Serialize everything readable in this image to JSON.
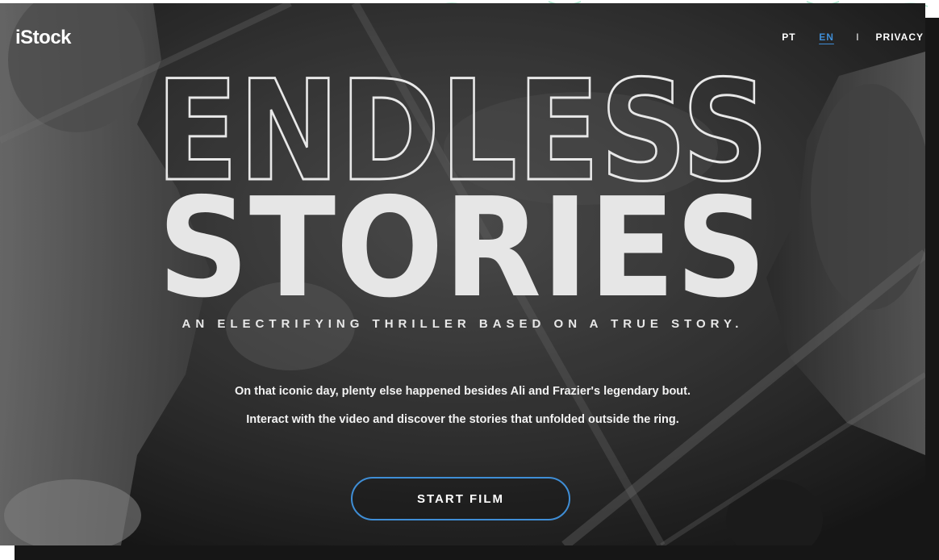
{
  "header": {
    "logo_text": "iStock",
    "nav": {
      "lang_pt": "PT",
      "lang_en": "EN",
      "separator": "I",
      "privacy": "PRIVACY"
    }
  },
  "hero": {
    "headline_line1": "ENDLESS",
    "headline_line2": "STORIES",
    "tagline": "AN ELECTRIFYING THRILLER BASED ON A TRUE STORY.",
    "description_line1": "On that iconic day, plenty else happened besides Ali and Frazier's legendary bout.",
    "description_line2": "Interact with the video and discover the stories that unfolded outside the ring.",
    "cta_label": "START FILM"
  },
  "colors": {
    "accent": "#3f8ed6",
    "background": "#3a3a3a",
    "text": "#ffffff",
    "top_decoration": "#6fd3a8"
  }
}
